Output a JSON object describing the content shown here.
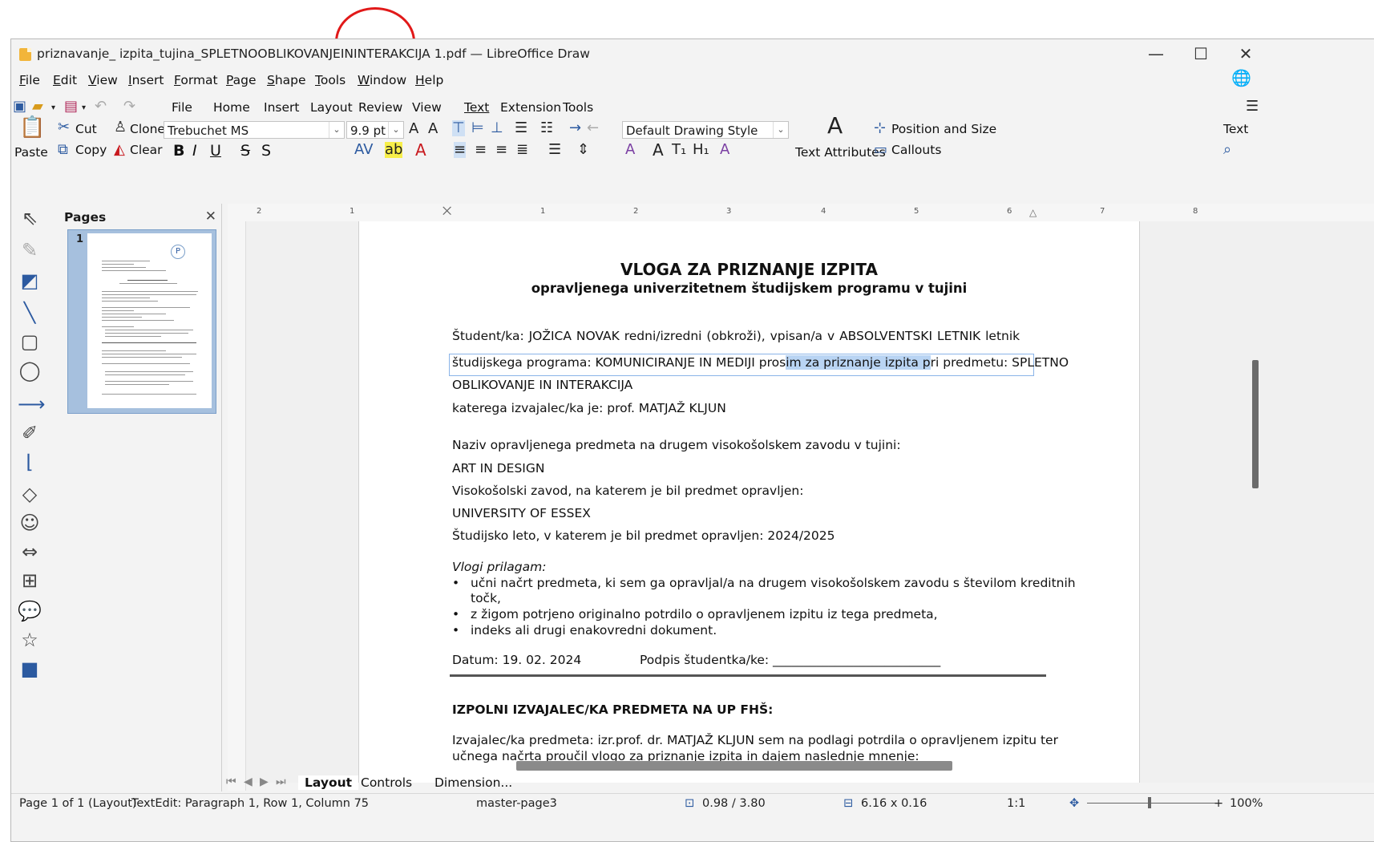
{
  "window": {
    "title": "priznavanje_ izpita_tujina_SPLETNOOBLIKOVANJEININTERAKCIJA 1.pdf — LibreOffice Draw",
    "minimize": "—",
    "maximize": "☐",
    "close": "✕"
  },
  "menu": [
    "File",
    "Edit",
    "View",
    "Insert",
    "Format",
    "Page",
    "Shape",
    "Tools",
    "Window",
    "Help"
  ],
  "tabs": [
    "File",
    "Home",
    "Insert",
    "Layout",
    "Review",
    "View",
    "Text",
    "Extension",
    "Tools"
  ],
  "ribbon": {
    "paste": "Paste",
    "cut": "Cut",
    "copy": "Copy",
    "clone": "Clone",
    "clear": "Clear",
    "font_name": "Trebuchet MS",
    "font_size": "9.9 pt",
    "style": "Default Drawing Style",
    "text_attributes": "Text Attributes",
    "position_size": "Position and Size",
    "callouts": "Callouts",
    "text_right": "Text",
    "bold": "B",
    "italic": "I",
    "underline": "U",
    "strike": "S",
    "shadow": "S"
  },
  "pages_pane": {
    "title": "Pages",
    "page_number": "1"
  },
  "ruler": [
    "2",
    "1",
    "1",
    "2",
    "3",
    "4",
    "5",
    "6",
    "7",
    "8"
  ],
  "document": {
    "title": "VLOGA ZA PRIZNANJE IZPITA",
    "subtitle": "opravljenega univerzitetnem študijskem programu v tujini",
    "line1": "Študent/ka:  JOŽICA  NOVAK  redni/izredni  (obkroži),  vpisan/a  v  ABSOLVENTSKI  LETNIK  letnik",
    "line2_a": "študijskega programa: KOMUNICIRANJE IN MEDIJI pros",
    "line2_sel": "im za priznanje izpita p",
    "line2_b": "ri predmetu: SPLETNO",
    "line3": "OBLIKOVANJE IN INTERAKCIJA",
    "line4": "katerega izvajalec/ka je: prof. MATJAŽ KLJUN",
    "line5": "Naziv opravljenega predmeta na drugem visokošolskem zavodu v tujini:",
    "line6": "ART IN DESIGN",
    "line7": "Visokošolski zavod, na katerem je bil predmet opravljen:",
    "line8": "UNIVERSITY OF ESSEX",
    "line9": "Študijsko leto, v katerem je bil predmet opravljen: 2024/2025",
    "attach_heading": "Vlogi prilagam:",
    "bullet1a": "učni načrt predmeta, ki sem ga opravljal/a na drugem  visokošolskem zavodu s številom kreditnih",
    "bullet1b": "točk,",
    "bullet2": "z žigom potrjeno originalno potrdilo o opravljenem izpitu iz tega predmeta,",
    "bullet3": "indeks ali drugi enakovredni dokument.",
    "date": "Datum: 19. 02. 2024",
    "signature": "Podpis študentka/ke: ___________________________",
    "section2": "IZPOLNI IZVAJALEC/KA PREDMETA NA UP FHŠ:",
    "line10": "Izvajalec/ka predmeta: izr.prof. dr. MATJAŽ KLJUN sem na podlagi potrdila o opravljenem izpitu ter",
    "line11": "učnega načrta proučil vlogo za priznanje izpita in dajem naslednje mnenje:"
  },
  "bottom_tabs": [
    "Layout",
    "Controls",
    "Dimension..."
  ],
  "status": {
    "page": "Page 1 of 1 (Layout)",
    "edit": "TextEdit: Paragraph 1, Row 1, Column 75",
    "master": "master-page3",
    "position": "0.98 / 3.80",
    "size": "6.16 x 0.16",
    "scale": "1:1",
    "zoom": "100%"
  }
}
